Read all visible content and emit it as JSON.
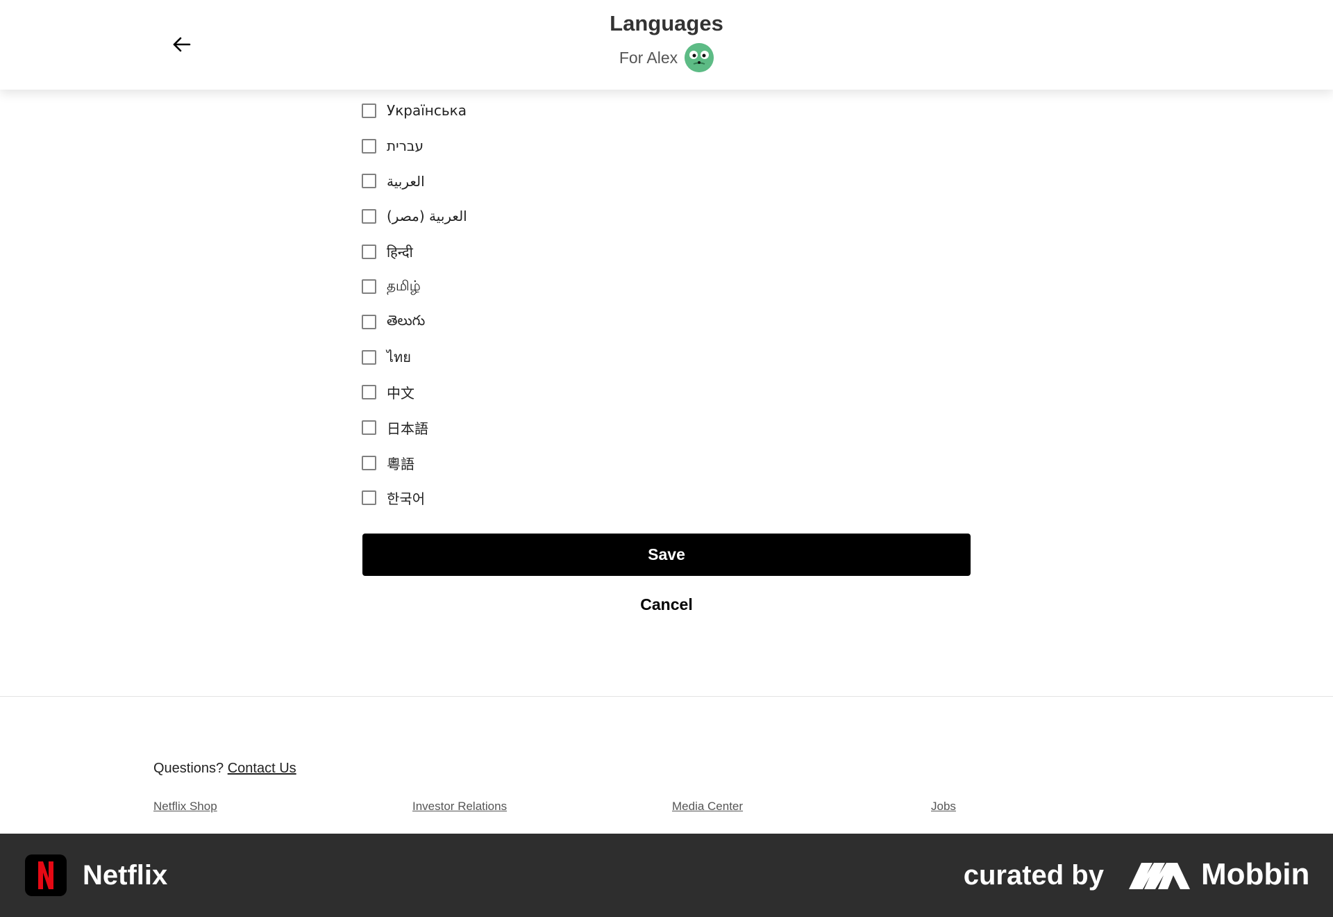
{
  "header": {
    "title": "Languages",
    "subtitle": "For Alex",
    "back_icon": "arrow-left-icon"
  },
  "languages": [
    {
      "label": "Українська",
      "checked": false
    },
    {
      "label": "עברית",
      "checked": false
    },
    {
      "label": "العربية",
      "checked": false
    },
    {
      "label": "العربية (مصر)",
      "checked": false
    },
    {
      "label": "हिन्दी",
      "checked": false
    },
    {
      "label": "தமிழ்",
      "checked": false
    },
    {
      "label": "తెలుగు",
      "checked": false
    },
    {
      "label": "ไทย",
      "checked": false
    },
    {
      "label": "中文",
      "checked": false
    },
    {
      "label": "日本語",
      "checked": false
    },
    {
      "label": "粵語",
      "checked": false
    },
    {
      "label": "한국어",
      "checked": false
    }
  ],
  "actions": {
    "save_label": "Save",
    "cancel_label": "Cancel"
  },
  "footer": {
    "questions_text": "Questions?",
    "contact_link": "Contact Us",
    "links": [
      "Netflix Shop",
      "Investor Relations",
      "Media Center",
      "Jobs"
    ]
  },
  "brand_bar": {
    "app_name": "Netflix",
    "curated_by": "curated by",
    "curator": "Mobbin"
  },
  "colors": {
    "primary_button": "#000000",
    "brand_bar_bg": "#2e2e2e",
    "netflix_red": "#e50914",
    "avatar_green": "#5dbb85"
  }
}
